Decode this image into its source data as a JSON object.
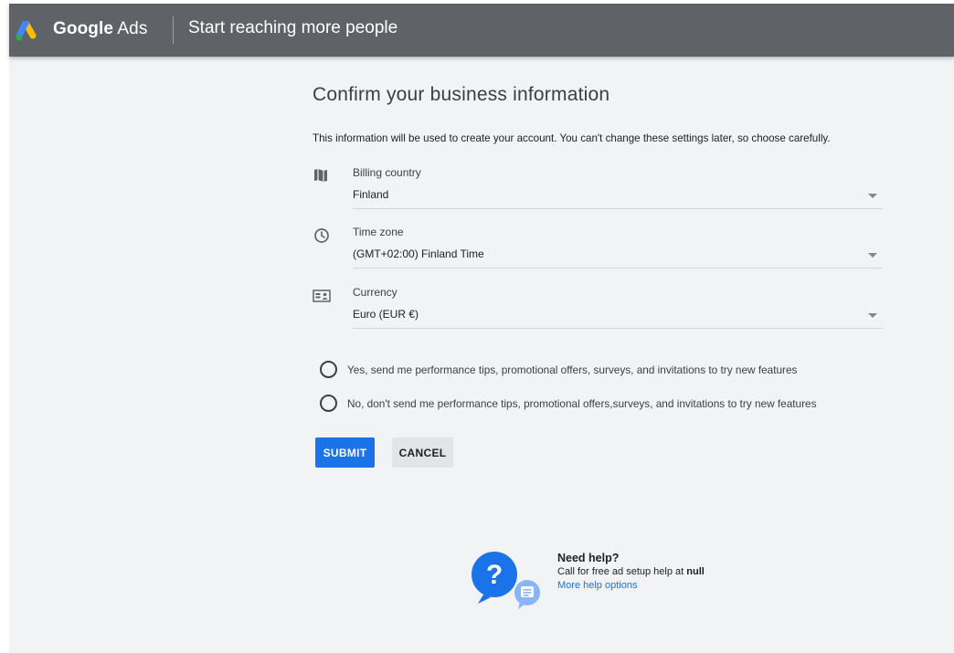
{
  "header": {
    "brand_google": "Google",
    "brand_ads": "Ads",
    "title": "Start reaching more people"
  },
  "main": {
    "heading": "Confirm your business information",
    "intro": "This information will be used to create your account. You can't change these settings later, so choose carefully.",
    "fields": [
      {
        "label": "Billing country",
        "value": "Finland",
        "icon": "map-icon"
      },
      {
        "label": "Time zone",
        "value": "(GMT+02:00) Finland Time",
        "icon": "clock-icon"
      },
      {
        "label": "Currency",
        "value": "Euro (EUR €)",
        "icon": "money-icon"
      }
    ],
    "options": [
      {
        "label": "Yes, send me performance tips, promotional offers, surveys, and invitations to try new features",
        "selected": false
      },
      {
        "label": "No, don't send me performance tips, promotional offers,surveys, and invitations to try new features",
        "selected": false
      }
    ],
    "submit_label": "SUBMIT",
    "cancel_label": "CANCEL"
  },
  "help": {
    "title": "Need help?",
    "line_prefix": "Call for free ad setup help at",
    "phone": "null",
    "link": "More help options"
  },
  "colors": {
    "header_bg": "#5f6368",
    "page_bg": "#f1f3f4",
    "primary": "#1a73e8"
  }
}
